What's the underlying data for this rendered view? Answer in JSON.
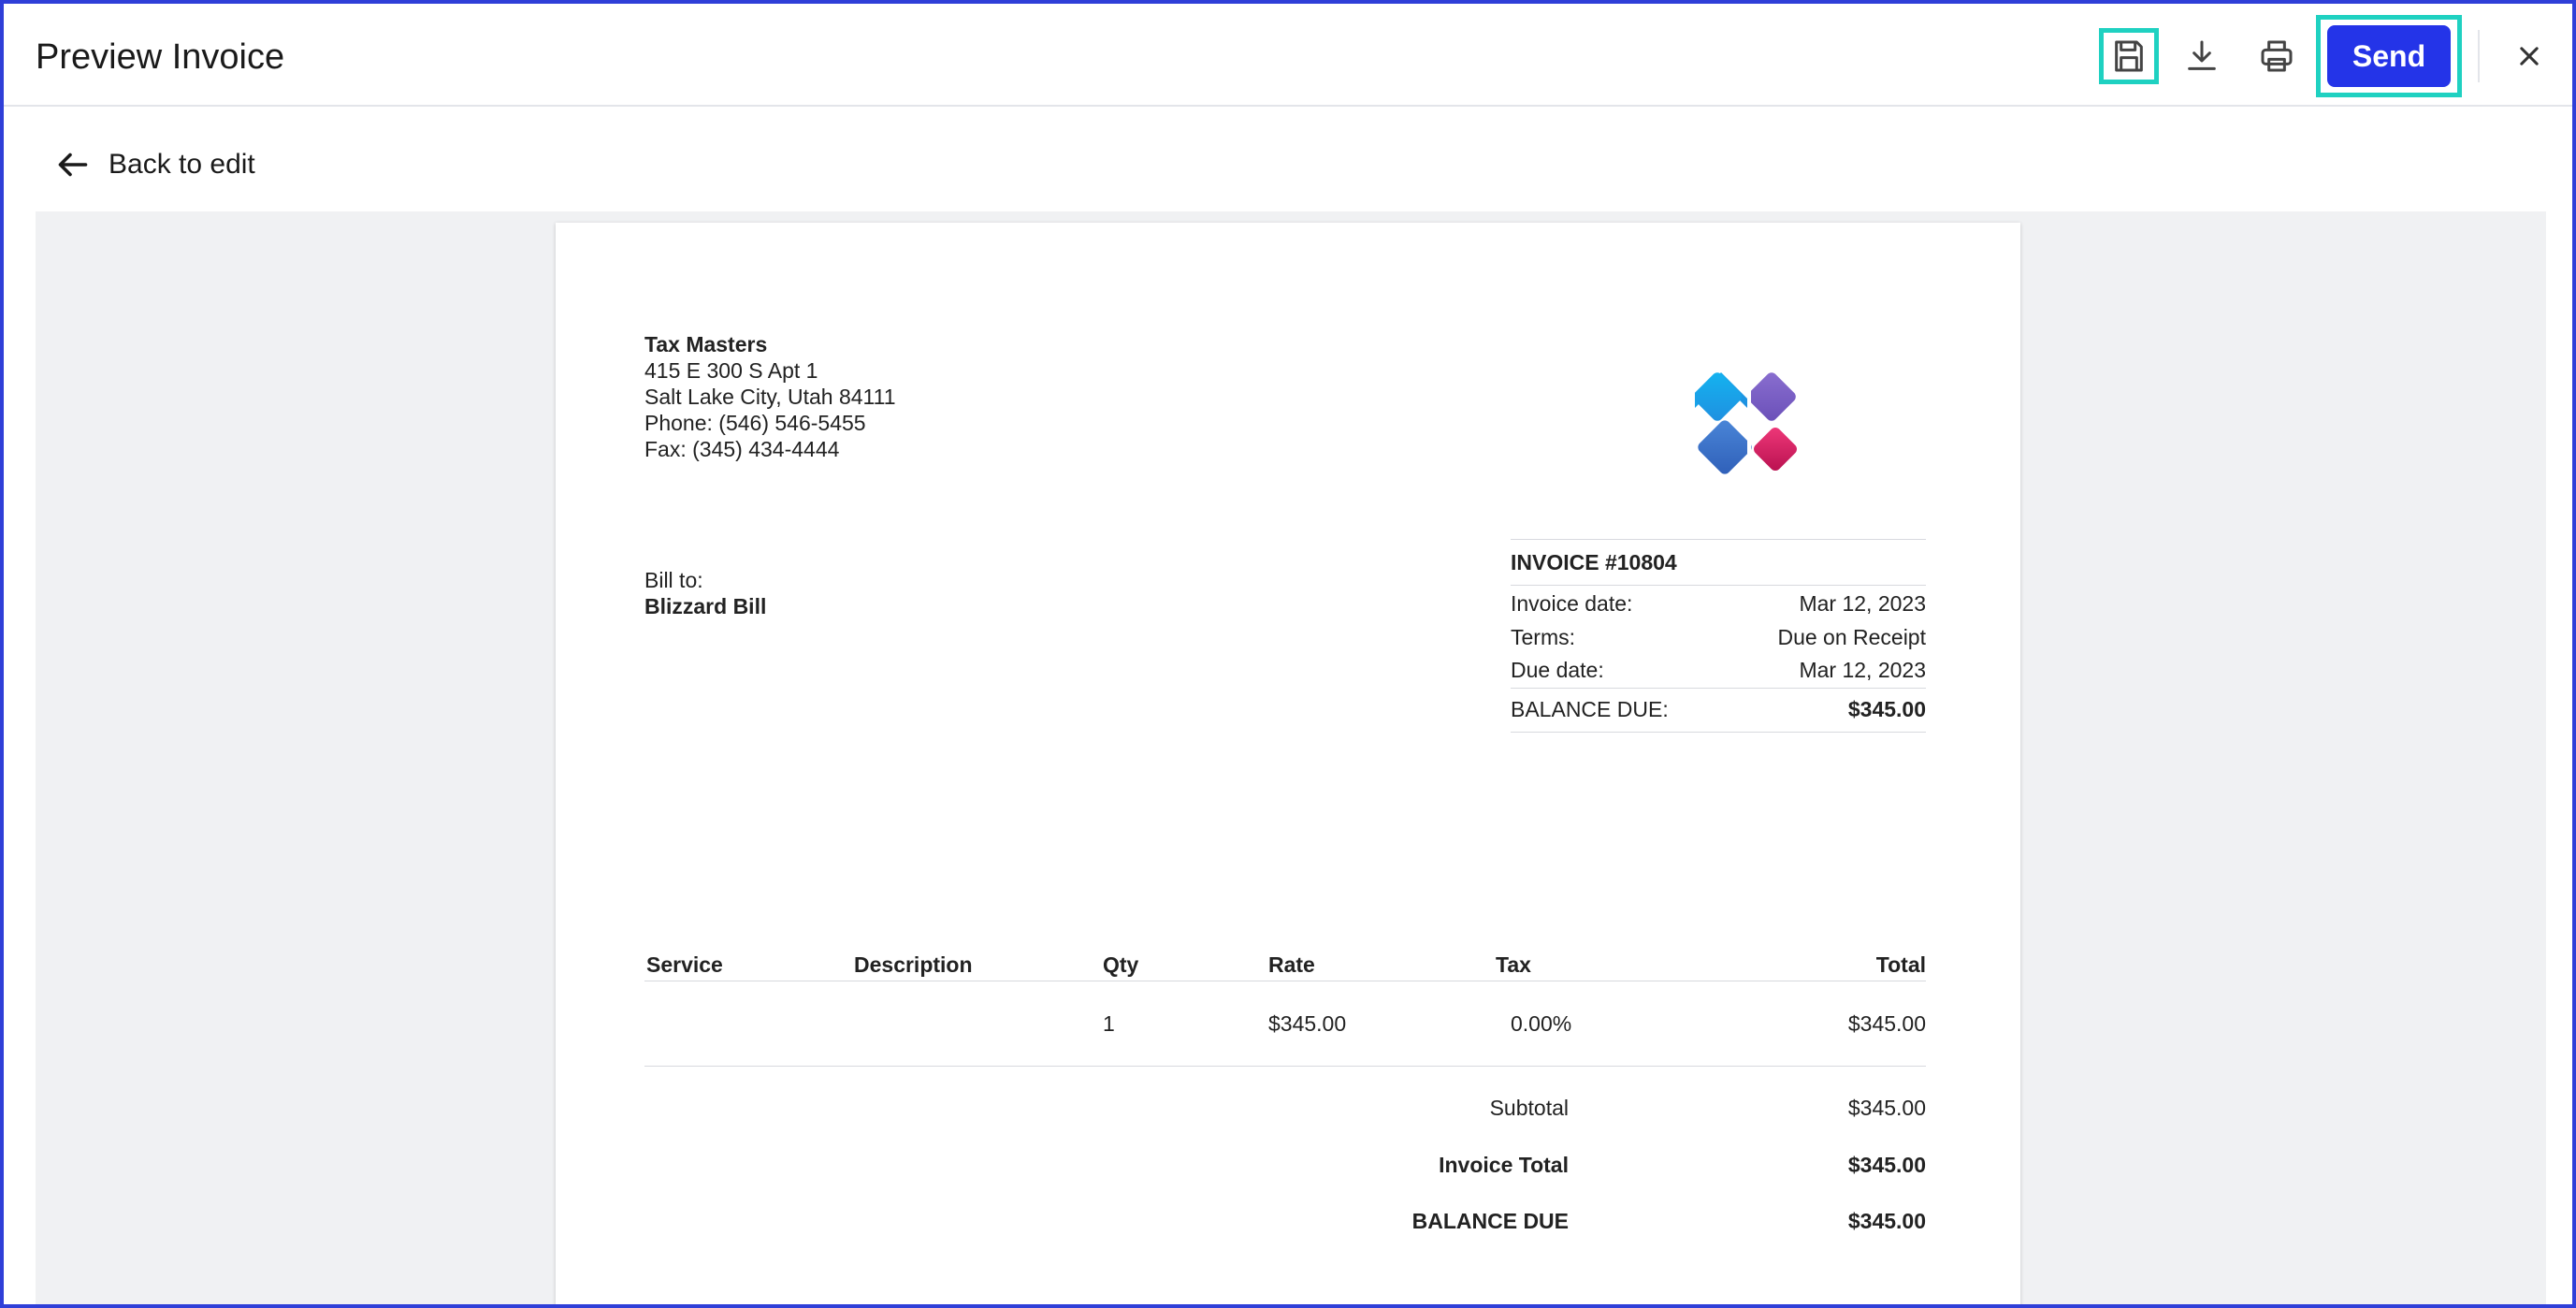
{
  "header": {
    "title": "Preview Invoice",
    "send_label": "Send"
  },
  "icons": {
    "save": "save-icon",
    "download": "download-icon",
    "print": "print-icon",
    "close": "close-icon",
    "back": "arrow-left-icon"
  },
  "colors": {
    "accent": "#2434e8",
    "highlight": "#1fd1c1",
    "frame": "#2f3fd8"
  },
  "back_link": {
    "label": "Back to edit"
  },
  "company": {
    "name": "Tax Masters",
    "address1": "415 E 300 S Apt 1",
    "address2": "Salt Lake City, Utah 84111",
    "phone": "Phone: (546) 546-5455",
    "fax": "Fax: (345) 434-4444"
  },
  "bill_to": {
    "label": "Bill to:",
    "name": "Blizzard Bill"
  },
  "invoice": {
    "number": "INVOICE #10804",
    "date_label": "Invoice date:",
    "date_value": "Mar 12, 2023",
    "terms_label": "Terms:",
    "terms_value": "Due on Receipt",
    "due_label": "Due date:",
    "due_value": "Mar 12, 2023",
    "balance_label": "BALANCE DUE:",
    "balance_value": "$345.00"
  },
  "table": {
    "columns": [
      "Service",
      "Description",
      "Qty",
      "Rate",
      "Tax",
      "Total"
    ],
    "rows": [
      [
        "",
        "",
        "1",
        "$345.00",
        "0.00%",
        "$345.00"
      ]
    ]
  },
  "totals": {
    "subtotal_label": "Subtotal",
    "subtotal_value": "$345.00",
    "invoice_total_label": "Invoice Total",
    "invoice_total_value": "$345.00",
    "balance_due_label": "BALANCE DUE",
    "balance_due_value": "$345.00"
  }
}
